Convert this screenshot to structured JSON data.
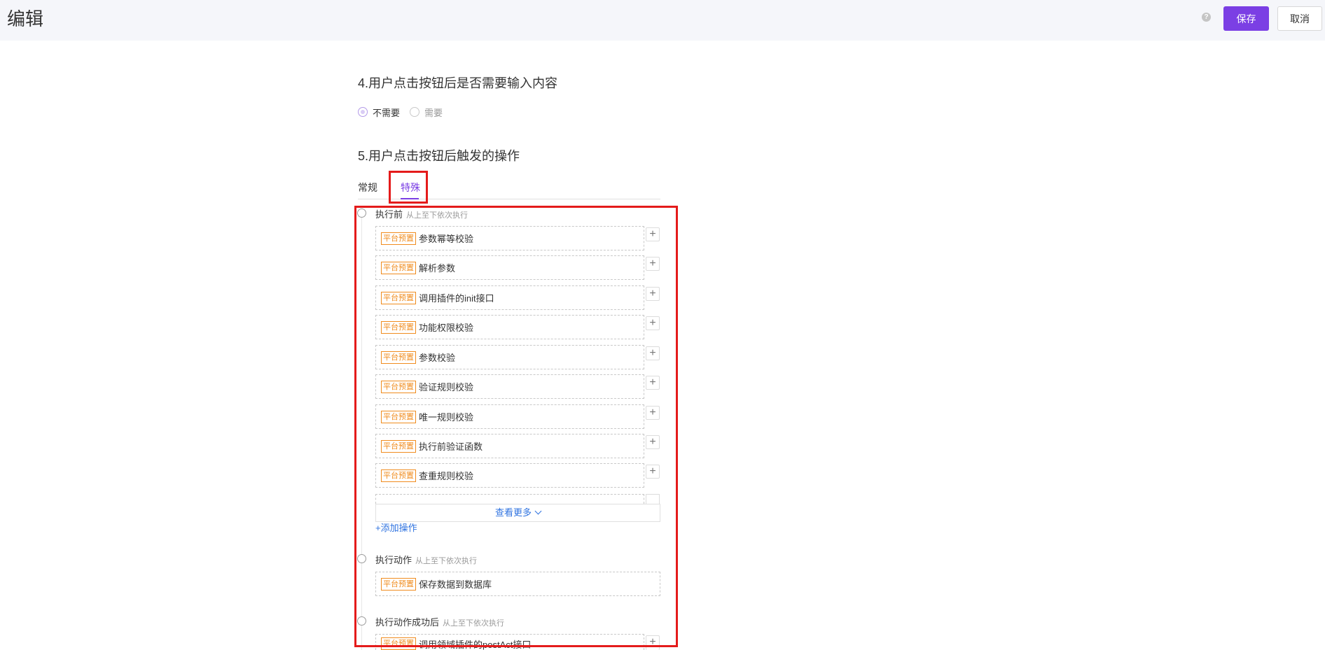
{
  "header": {
    "title": "编辑",
    "help_icon": "help-icon",
    "help_glyph": "?",
    "save_label": "保存",
    "cancel_label": "取消"
  },
  "section4": {
    "title": "4.用户点击按钮后是否需要输入内容",
    "options": [
      {
        "label": "不需要",
        "checked": true
      },
      {
        "label": "需要",
        "checked": false
      }
    ]
  },
  "section5": {
    "title": "5.用户点击按钮后触发的操作",
    "tabs": [
      {
        "label": "常规",
        "active": false
      },
      {
        "label": "特殊",
        "active": true
      }
    ]
  },
  "steps": {
    "before": {
      "title": "执行前",
      "subtitle": "从上至下依次执行",
      "tag": "平台预置",
      "items": [
        "参数幂等校验",
        "解析参数",
        "调用插件的init接口",
        "功能权限校验",
        "参数校验",
        "验证规则校验",
        "唯一规则校验",
        "执行前验证函数",
        "查重规则校验"
      ],
      "more_label": "查看更多",
      "add_label": "+添加操作"
    },
    "action": {
      "title": "执行动作",
      "subtitle": "从上至下依次执行",
      "tag": "平台预置",
      "items": [
        "保存数据到数据库"
      ]
    },
    "after": {
      "title": "执行动作成功后",
      "subtitle": "从上至下依次执行",
      "tag": "平台预置",
      "items": [
        "调用领域插件的postAct接口"
      ]
    }
  },
  "colors": {
    "accent": "#7b3fe4",
    "link": "#2f73e0",
    "tag": "#f08c1e",
    "highlight": "#e41b1b"
  }
}
